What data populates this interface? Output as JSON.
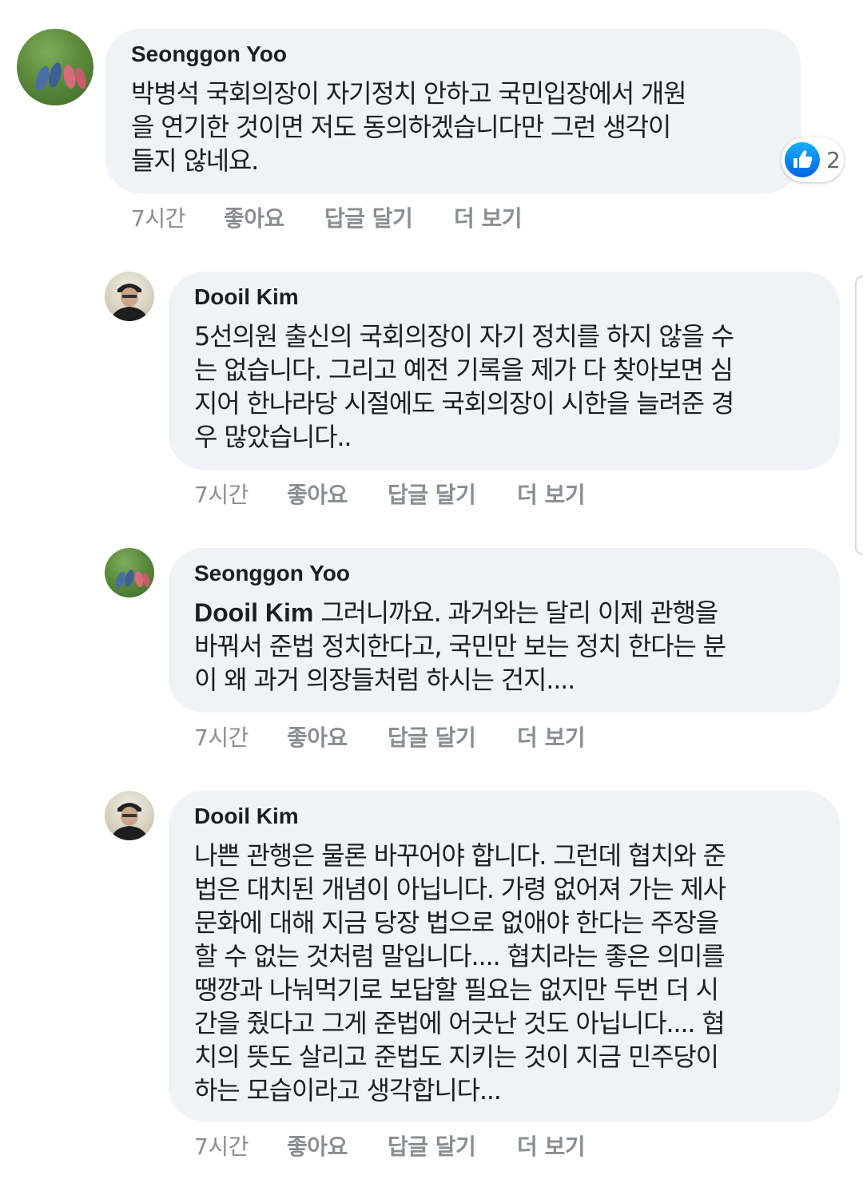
{
  "colors": {
    "bubble": "#f0f2f5",
    "text": "#1c1e21",
    "meta": "#8a8d91",
    "like_blue": "#1877f2"
  },
  "comments": [
    {
      "author": "Seonggon Yoo",
      "avatar": "grass-feet-avatar",
      "lines": [
        "박병석 국회의장이 자기정치 안하고 국민입장에서 개원",
        "을 연기한 것이면 저도 동의하겠습니다만 그런 생각이",
        "들지 않네요."
      ],
      "time": "7시간",
      "like": "좋아요",
      "reply": "답글 달기",
      "more": "더 보기",
      "reaction": {
        "icon": "thumbs-up-icon",
        "count": "2"
      }
    },
    {
      "author": "Dooil Kim",
      "avatar": "man-with-cap-avatar",
      "lines": [
        "5선의원 출신의 국회의장이 자기 정치를 하지 않을 수",
        "는 없습니다. 그리고 예전 기록을 제가 다 찾아보면 심",
        "지어 한나라당 시절에도 국회의장이 시한을 늘려준 경",
        "우 많았습니다.."
      ],
      "time": "7시간",
      "like": "좋아요",
      "reply": "답글 달기",
      "more": "더 보기"
    },
    {
      "author": "Seonggon Yoo",
      "avatar": "grass-feet-avatar",
      "mention": "Dooil Kim",
      "lines": [
        " 그러니까요. 과거와는 달리 이제 관행을",
        "바꿔서 준법 정치한다고, 국민만 보는 정치 한다는 분",
        "이 왜 과거 의장들처럼 하시는 건지...."
      ],
      "time": "7시간",
      "like": "좋아요",
      "reply": "답글 달기",
      "more": "더 보기"
    },
    {
      "author": "Dooil Kim",
      "avatar": "man-with-cap-avatar",
      "lines": [
        "나쁜 관행은 물론 바꾸어야 합니다. 그런데 협치와 준",
        "법은 대치된 개념이 아닙니다. 가령 없어져 가는 제사",
        "문화에 대해 지금 당장 법으로 없애야 한다는 주장을",
        "할 수 없는 것처럼 말입니다.... 협치라는 좋은 의미를",
        "땡깡과 나눠먹기로 보답할 필요는 없지만 두번 더 시",
        "간을 줬다고 그게 준법에 어긋난 것도 아닙니다.... 협",
        "치의 뜻도 살리고 준법도 지키는 것이 지금 민주당이",
        "하는 모습이라고 생각합니다..."
      ],
      "time": "7시간",
      "like": "좋아요",
      "reply": "답글 달기",
      "more": "더 보기"
    }
  ]
}
